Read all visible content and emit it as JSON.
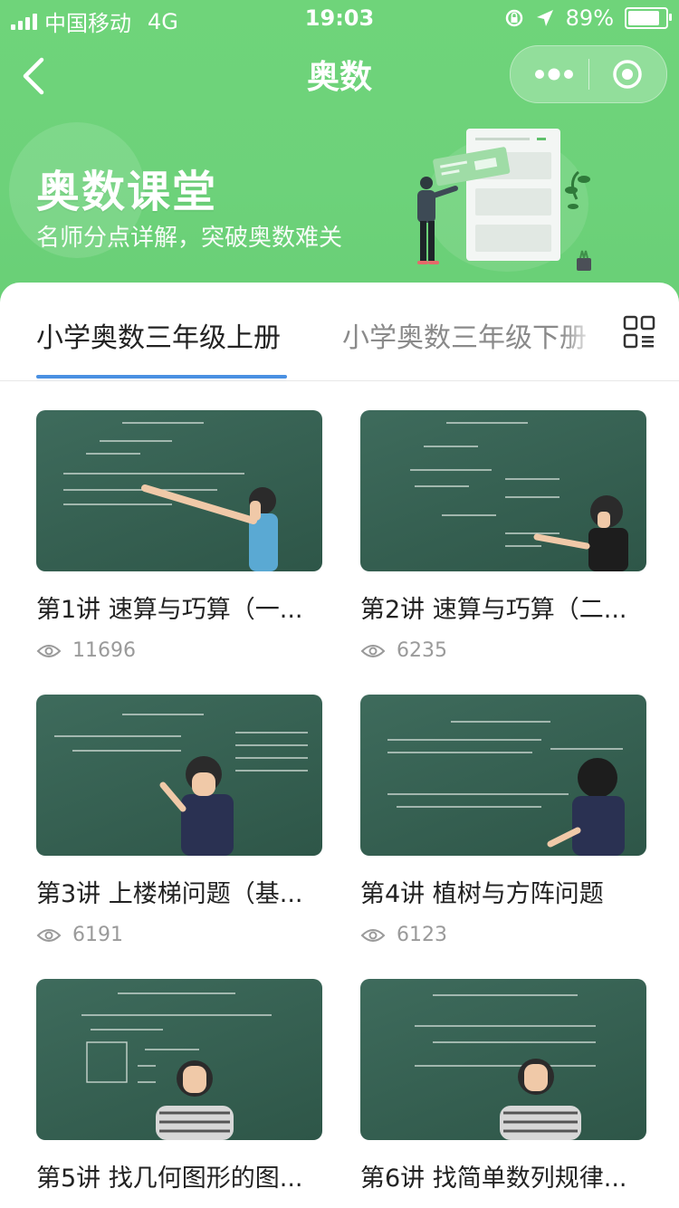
{
  "status_bar": {
    "carrier": "中国移动",
    "network": "4G",
    "time": "19:03",
    "battery": "89%",
    "battery_level": 0.89
  },
  "nav": {
    "title": "奥数"
  },
  "hero": {
    "title": "奥数课堂",
    "subtitle": "名师分点详解，突破奥数难关"
  },
  "tabs": [
    {
      "label": "小学奥数三年级上册",
      "active": true
    },
    {
      "label": "小学奥数三年级下册",
      "active": false
    }
  ],
  "lessons": [
    {
      "title": "第1讲 速算与巧算（一...",
      "views": "11696"
    },
    {
      "title": "第2讲 速算与巧算（二...",
      "views": "6235"
    },
    {
      "title": "第3讲 上楼梯问题（基...",
      "views": "6191"
    },
    {
      "title": "第4讲 植树与方阵问题",
      "views": "6123"
    },
    {
      "title": "第5讲 找几何图形的图...",
      "views": ""
    },
    {
      "title": "第6讲 找简单数列规律...",
      "views": ""
    }
  ],
  "colors": {
    "brand_green": "#6fd47a",
    "tab_underline": "#4a90e2",
    "chalkboard": "#3a6455"
  }
}
